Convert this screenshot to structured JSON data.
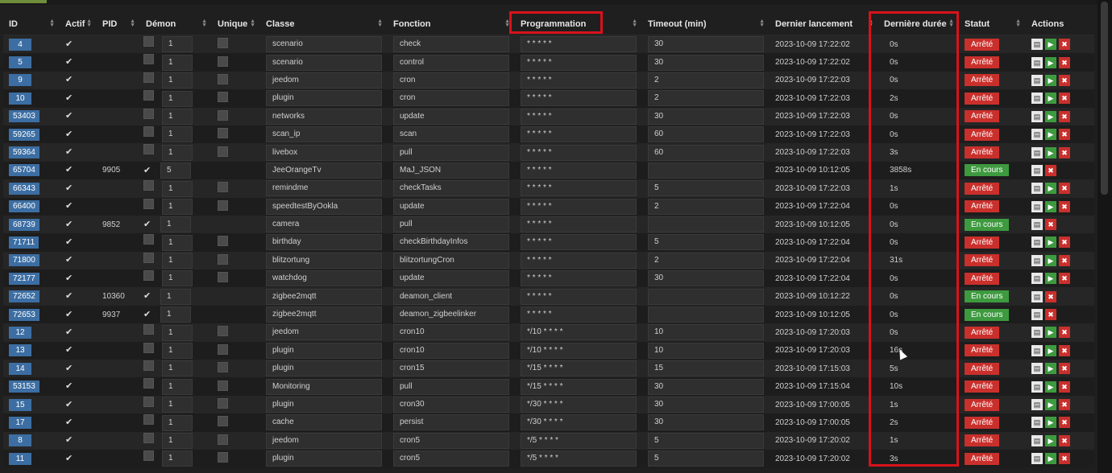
{
  "headers": {
    "id": "ID",
    "actif": "Actif",
    "pid": "PID",
    "demon": "Démon",
    "unique": "Unique",
    "classe": "Classe",
    "fonction": "Fonction",
    "programmation": "Programmation",
    "timeout": "Timeout (min)",
    "dernier_lancement": "Dernier lancement",
    "derniere_duree": "Dernière durée",
    "statut": "Statut",
    "actions": "Actions"
  },
  "colors": {
    "accent_blue": "#3c6ea3",
    "status_stopped": "#c9302c",
    "status_running": "#3e9a3f",
    "highlight": "#d9121c"
  },
  "rows": [
    {
      "id": "4",
      "pid": "",
      "demon": false,
      "count": "1",
      "classe": "scenario",
      "fonction": "check",
      "prog": "* * * * *",
      "timeout": "30",
      "last": "2023-10-09 17:22:02",
      "dur": "0s",
      "status": "Arrêté",
      "running": false
    },
    {
      "id": "5",
      "pid": "",
      "demon": false,
      "count": "1",
      "classe": "scenario",
      "fonction": "control",
      "prog": "* * * * *",
      "timeout": "30",
      "last": "2023-10-09 17:22:02",
      "dur": "0s",
      "status": "Arrêté",
      "running": false
    },
    {
      "id": "9",
      "pid": "",
      "demon": false,
      "count": "1",
      "classe": "jeedom",
      "fonction": "cron",
      "prog": "* * * * *",
      "timeout": "2",
      "last": "2023-10-09 17:22:03",
      "dur": "0s",
      "status": "Arrêté",
      "running": false
    },
    {
      "id": "10",
      "pid": "",
      "demon": false,
      "count": "1",
      "classe": "plugin",
      "fonction": "cron",
      "prog": "* * * * *",
      "timeout": "2",
      "last": "2023-10-09 17:22:03",
      "dur": "2s",
      "status": "Arrêté",
      "running": false
    },
    {
      "id": "53403",
      "pid": "",
      "demon": false,
      "count": "1",
      "classe": "networks",
      "fonction": "update",
      "prog": "* * * * *",
      "timeout": "30",
      "last": "2023-10-09 17:22:03",
      "dur": "0s",
      "status": "Arrêté",
      "running": false
    },
    {
      "id": "59265",
      "pid": "",
      "demon": false,
      "count": "1",
      "classe": "scan_ip",
      "fonction": "scan",
      "prog": "* * * * *",
      "timeout": "60",
      "last": "2023-10-09 17:22:03",
      "dur": "0s",
      "status": "Arrêté",
      "running": false
    },
    {
      "id": "59364",
      "pid": "",
      "demon": false,
      "count": "1",
      "classe": "livebox",
      "fonction": "pull",
      "prog": "* * * * *",
      "timeout": "60",
      "last": "2023-10-09 17:22:03",
      "dur": "3s",
      "status": "Arrêté",
      "running": false
    },
    {
      "id": "65704",
      "pid": "9905",
      "demon": true,
      "count": "5",
      "classe": "JeeOrangeTv",
      "fonction": "MaJ_JSON",
      "prog": "* * * * *",
      "timeout": "",
      "last": "2023-10-09 10:12:05",
      "dur": "3858s",
      "status": "En cours",
      "running": true
    },
    {
      "id": "66343",
      "pid": "",
      "demon": false,
      "count": "1",
      "classe": "remindme",
      "fonction": "checkTasks",
      "prog": "* * * * *",
      "timeout": "5",
      "last": "2023-10-09 17:22:03",
      "dur": "1s",
      "status": "Arrêté",
      "running": false
    },
    {
      "id": "66400",
      "pid": "",
      "demon": false,
      "count": "1",
      "classe": "speedtestByOokla",
      "fonction": "update",
      "prog": "* * * * *",
      "timeout": "2",
      "last": "2023-10-09 17:22:04",
      "dur": "0s",
      "status": "Arrêté",
      "running": false
    },
    {
      "id": "68739",
      "pid": "9852",
      "demon": true,
      "count": "1",
      "classe": "camera",
      "fonction": "pull",
      "prog": "* * * * *",
      "timeout": "",
      "last": "2023-10-09 10:12:05",
      "dur": "0s",
      "status": "En cours",
      "running": true
    },
    {
      "id": "71711",
      "pid": "",
      "demon": false,
      "count": "1",
      "classe": "birthday",
      "fonction": "checkBirthdayInfos",
      "prog": "* * * * *",
      "timeout": "5",
      "last": "2023-10-09 17:22:04",
      "dur": "0s",
      "status": "Arrêté",
      "running": false
    },
    {
      "id": "71800",
      "pid": "",
      "demon": false,
      "count": "1",
      "classe": "blitzortung",
      "fonction": "blitzortungCron",
      "prog": "* * * * *",
      "timeout": "2",
      "last": "2023-10-09 17:22:04",
      "dur": "31s",
      "status": "Arrêté",
      "running": false
    },
    {
      "id": "72177",
      "pid": "",
      "demon": false,
      "count": "1",
      "classe": "watchdog",
      "fonction": "update",
      "prog": "* * * * *",
      "timeout": "30",
      "last": "2023-10-09 17:22:04",
      "dur": "0s",
      "status": "Arrêté",
      "running": false
    },
    {
      "id": "72652",
      "pid": "10360",
      "demon": true,
      "count": "1",
      "classe": "zigbee2mqtt",
      "fonction": "deamon_client",
      "prog": "* * * * *",
      "timeout": "",
      "last": "2023-10-09 10:12:22",
      "dur": "0s",
      "status": "En cours",
      "running": true
    },
    {
      "id": "72653",
      "pid": "9937",
      "demon": true,
      "count": "1",
      "classe": "zigbee2mqtt",
      "fonction": "deamon_zigbeelinker",
      "prog": "* * * * *",
      "timeout": "",
      "last": "2023-10-09 10:12:05",
      "dur": "0s",
      "status": "En cours",
      "running": true
    },
    {
      "id": "12",
      "pid": "",
      "demon": false,
      "count": "1",
      "classe": "jeedom",
      "fonction": "cron10",
      "prog": "*/10 * * * *",
      "timeout": "10",
      "last": "2023-10-09 17:20:03",
      "dur": "0s",
      "status": "Arrêté",
      "running": false
    },
    {
      "id": "13",
      "pid": "",
      "demon": false,
      "count": "1",
      "classe": "plugin",
      "fonction": "cron10",
      "prog": "*/10 * * * *",
      "timeout": "10",
      "last": "2023-10-09 17:20:03",
      "dur": "16s",
      "status": "Arrêté",
      "running": false
    },
    {
      "id": "14",
      "pid": "",
      "demon": false,
      "count": "1",
      "classe": "plugin",
      "fonction": "cron15",
      "prog": "*/15 * * * *",
      "timeout": "15",
      "last": "2023-10-09 17:15:03",
      "dur": "5s",
      "status": "Arrêté",
      "running": false
    },
    {
      "id": "53153",
      "pid": "",
      "demon": false,
      "count": "1",
      "classe": "Monitoring",
      "fonction": "pull",
      "prog": "*/15 * * * *",
      "timeout": "30",
      "last": "2023-10-09 17:15:04",
      "dur": "10s",
      "status": "Arrêté",
      "running": false
    },
    {
      "id": "15",
      "pid": "",
      "demon": false,
      "count": "1",
      "classe": "plugin",
      "fonction": "cron30",
      "prog": "*/30 * * * *",
      "timeout": "30",
      "last": "2023-10-09 17:00:05",
      "dur": "1s",
      "status": "Arrêté",
      "running": false
    },
    {
      "id": "17",
      "pid": "",
      "demon": false,
      "count": "1",
      "classe": "cache",
      "fonction": "persist",
      "prog": "*/30 * * * *",
      "timeout": "30",
      "last": "2023-10-09 17:00:05",
      "dur": "2s",
      "status": "Arrêté",
      "running": false
    },
    {
      "id": "8",
      "pid": "",
      "demon": false,
      "count": "1",
      "classe": "jeedom",
      "fonction": "cron5",
      "prog": "*/5 * * * *",
      "timeout": "5",
      "last": "2023-10-09 17:20:02",
      "dur": "1s",
      "status": "Arrêté",
      "running": false
    },
    {
      "id": "11",
      "pid": "",
      "demon": false,
      "count": "1",
      "classe": "plugin",
      "fonction": "cron5",
      "prog": "*/5 * * * *",
      "timeout": "5",
      "last": "2023-10-09 17:20:02",
      "dur": "3s",
      "status": "Arrêté",
      "running": false
    }
  ]
}
